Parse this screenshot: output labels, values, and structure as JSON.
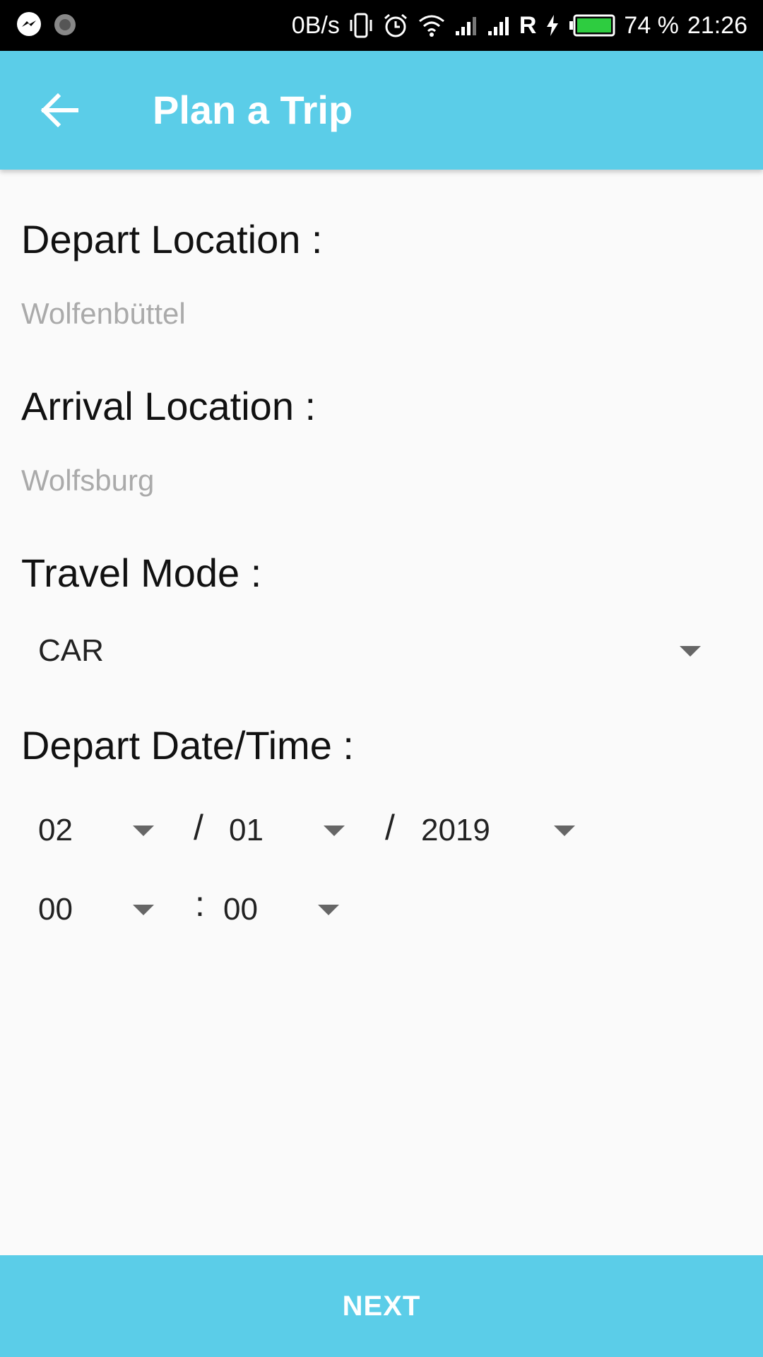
{
  "status_bar": {
    "net_speed": "0B/s",
    "roaming": "R",
    "battery_percent": "74 %",
    "time": "21:26",
    "icons": [
      "messenger-icon",
      "loading-icon",
      "vibrate-icon",
      "alarm-icon",
      "wifi-icon",
      "signal-icon",
      "signal-icon",
      "charging-icon",
      "battery-icon"
    ]
  },
  "appbar": {
    "title": "Plan a Trip",
    "back_icon": "arrow-left-icon"
  },
  "form": {
    "depart_location_label": "Depart Location :",
    "depart_location_value": "Wolfenbüttel",
    "arrival_location_label": "Arrival Location :",
    "arrival_location_value": "Wolfsburg",
    "travel_mode_label": "Travel Mode :",
    "travel_mode_value": "CAR",
    "depart_datetime_label": "Depart Date/Time :",
    "date": {
      "day": "02",
      "month": "01",
      "year": "2019",
      "separator": "/"
    },
    "time": {
      "hour": "00",
      "minute": "00",
      "separator": ":"
    }
  },
  "next_button": {
    "label": "NEXT"
  },
  "colors": {
    "accent": "#5bcde8",
    "background": "#fafafa",
    "hint": "#aaaaaa"
  }
}
